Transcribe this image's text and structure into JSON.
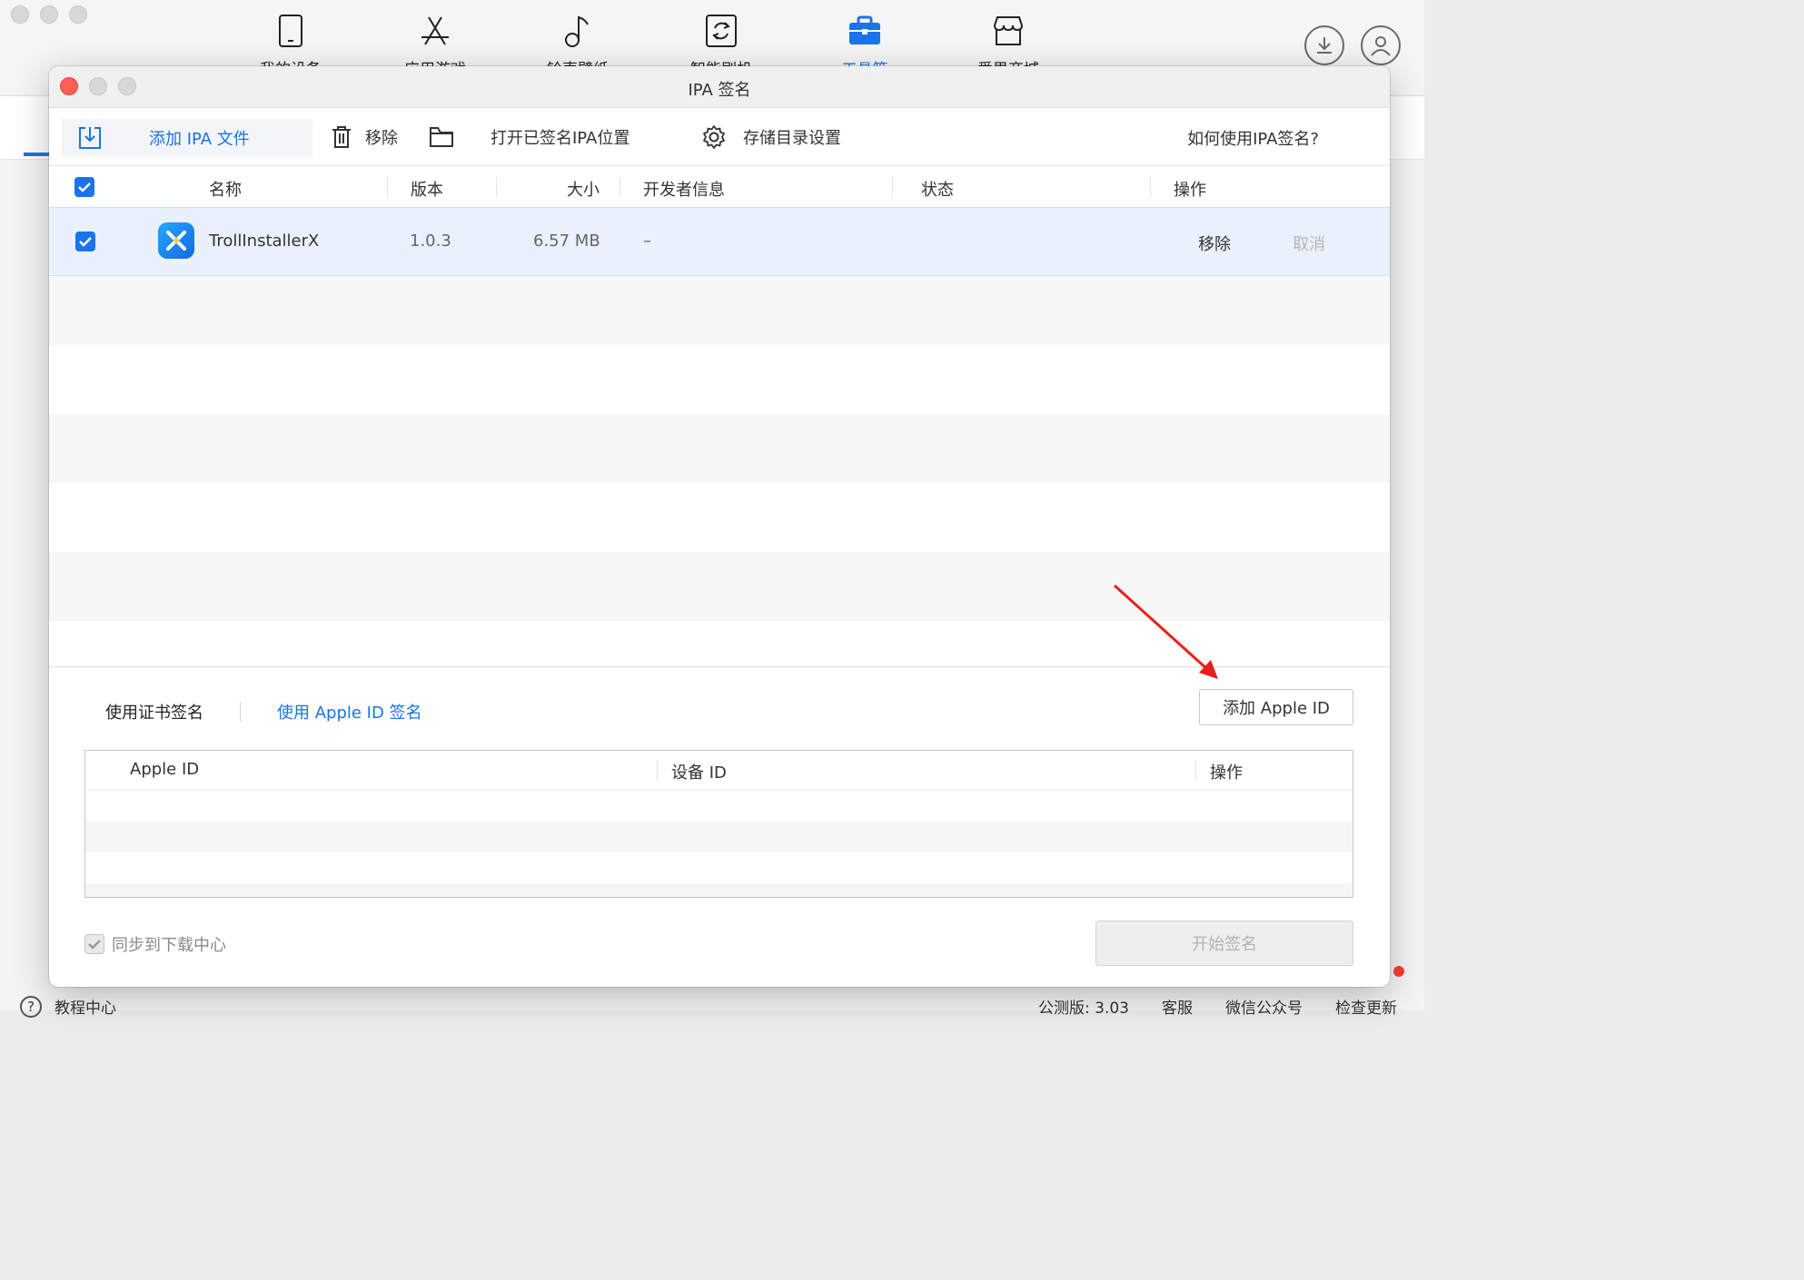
{
  "main_app": {
    "nav": [
      {
        "label": "我的设备",
        "icon": "phone-icon"
      },
      {
        "label": "应用游戏",
        "icon": "app-store-icon"
      },
      {
        "label": "铃声壁纸",
        "icon": "music-note-icon"
      },
      {
        "label": "智能刷机",
        "icon": "flash-icon"
      },
      {
        "label": "工具箱",
        "icon": "toolbox-icon",
        "active": true
      },
      {
        "label": "爱思商城",
        "icon": "store-icon"
      }
    ],
    "footer": {
      "tutorial": "教程中心",
      "version": "公测版: 3.03",
      "service": "客服",
      "wechat": "微信公众号",
      "update": "检查更新"
    }
  },
  "dialog": {
    "title": "IPA 签名",
    "toolbar": {
      "add_ipa": "添加 IPA 文件",
      "remove": "移除",
      "open_location": "打开已签名IPA位置",
      "storage_settings": "存储目录设置",
      "help": "如何使用IPA签名?"
    },
    "table": {
      "headers": {
        "name": "名称",
        "version": "版本",
        "size": "大小",
        "developer": "开发者信息",
        "status": "状态",
        "action": "操作"
      },
      "rows": [
        {
          "checked": true,
          "name": "TrollInstallerX",
          "version": "1.0.3",
          "size": "6.57 MB",
          "developer": "–",
          "status": "",
          "action_remove": "移除",
          "action_cancel": "取消"
        }
      ]
    },
    "sign_tabs": {
      "certificate": "使用证书签名",
      "apple_id": "使用 Apple ID 签名",
      "active": "apple_id"
    },
    "add_apple_id_button": "添加 Apple ID",
    "apple_id_table": {
      "headers": {
        "apple_id": "Apple ID",
        "device_id": "设备 ID",
        "action": "操作"
      },
      "rows": []
    },
    "sync_checkbox": {
      "label": "同步到下载中心",
      "checked": true,
      "disabled": true
    },
    "start_button": "开始签名"
  },
  "colors": {
    "accent": "#1a73e8",
    "selected_row": "#e8f1fc",
    "annotation_arrow": "#e8201a"
  }
}
